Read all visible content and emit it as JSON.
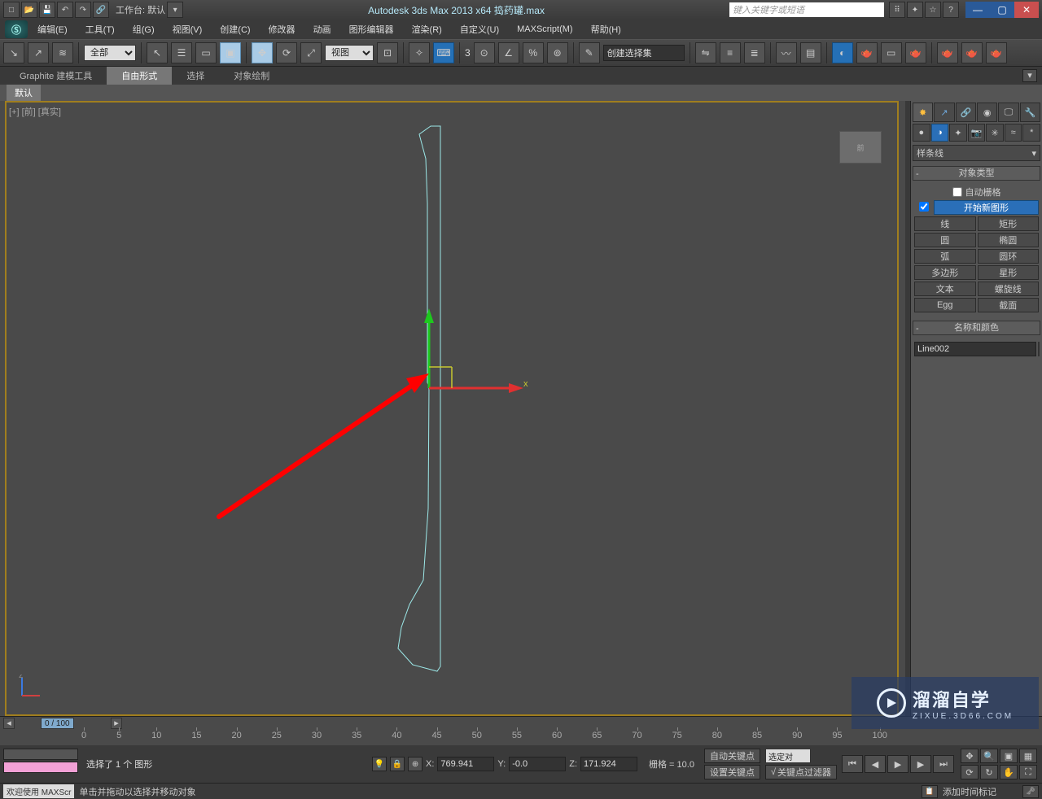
{
  "title": {
    "workspace_label": "工作台: 默认",
    "app_title": "Autodesk 3ds Max  2013 x64     捣药罐.max",
    "search_placeholder": "键入关键字或短语"
  },
  "menus": [
    "编辑(E)",
    "工具(T)",
    "组(G)",
    "视图(V)",
    "创建(C)",
    "修改器",
    "动画",
    "图形编辑器",
    "渲染(R)",
    "自定义(U)",
    "MAXScript(M)",
    "帮助(H)"
  ],
  "toolbar": {
    "filter_all": "全部",
    "ref_coord": "视图",
    "xyz_label": "3",
    "sel_sets_placeholder": "创建选择集"
  },
  "ribbon": {
    "tabs": [
      "Graphite 建模工具",
      "自由形式",
      "选择",
      "对象绘制"
    ],
    "sub": "默认"
  },
  "viewport": {
    "label": "[+] [前] [真实]",
    "cube": "前",
    "axis_y_label": "x"
  },
  "panel": {
    "category": "样条线",
    "rollout_obj_type": "对象类型",
    "auto_grid": "自动栅格",
    "start_new_shape": "开始新图形",
    "btns": [
      [
        "线",
        "矩形"
      ],
      [
        "圆",
        "椭圆"
      ],
      [
        "弧",
        "圆环"
      ],
      [
        "多边形",
        "星形"
      ],
      [
        "文本",
        "螺旋线"
      ],
      [
        "Egg",
        "截面"
      ]
    ],
    "rollout_name": "名称和颜色",
    "obj_name": "Line002"
  },
  "timeline": {
    "frame": "0 / 100",
    "ticks": [
      "0",
      "5",
      "10",
      "15",
      "20",
      "25",
      "30",
      "35",
      "40",
      "45",
      "50",
      "55",
      "60",
      "65",
      "70",
      "75",
      "80",
      "85",
      "90",
      "95",
      "100"
    ]
  },
  "status": {
    "selected": "选择了 1 个 图形",
    "x_label": "X:",
    "x_val": "769.941",
    "y_label": "Y:",
    "y_val": "-0.0",
    "z_label": "Z:",
    "z_val": "171.924",
    "grid": "栅格 = 10.0",
    "autokey": "自动关键点",
    "selset": "选定对",
    "setkey": "设置关键点",
    "keyfilter": "关键点过滤器",
    "welcome": "欢迎使用  MAXScr",
    "hint": "单击并拖动以选择并移动对象",
    "add_marker": "添加时间标记"
  },
  "watermark": {
    "line1": "溜溜自学",
    "line2": "ZIXUE.3D66.COM"
  },
  "icons": {
    "menu_app": "☰",
    "new": "□",
    "open": "📂",
    "save": "💾",
    "undo": "↶",
    "redo": "↷",
    "link": "🔗",
    "sel_obj": "⬚",
    "sel_rect": "▭",
    "sel_win": "▦",
    "sel_cross": "▣",
    "move": "✥",
    "rotate": "⟳",
    "scale": "⤢",
    "snap": "⬡",
    "angle": "∠",
    "percent": "%",
    "spinner": "🔧",
    "mirror": "⇋",
    "align": "≡",
    "layers": "🗂",
    "render": "🫖",
    "mat": "🔵",
    "curve": "〰",
    "cfg": "⚙",
    "help": "?",
    "min": "—",
    "max": "▢",
    "close": "✕",
    "create_tab": "✸",
    "modify_tab": "↗",
    "hier_tab": "🔗",
    "motion_tab": "◉",
    "disp_tab": "🖵",
    "util_tab": "🔧",
    "geom": "●",
    "shape": "◑",
    "light": "✦",
    "cam": "📷",
    "helper": "✳",
    "space": "≈",
    "sys": "*",
    "lock": "🔒",
    "key": "🔑",
    "abs": "⊕",
    "play_first": "⏮",
    "play_prev": "◀",
    "play": "▶",
    "play_next": "▶",
    "play_last": "⏭",
    "dropdown": "▾"
  }
}
